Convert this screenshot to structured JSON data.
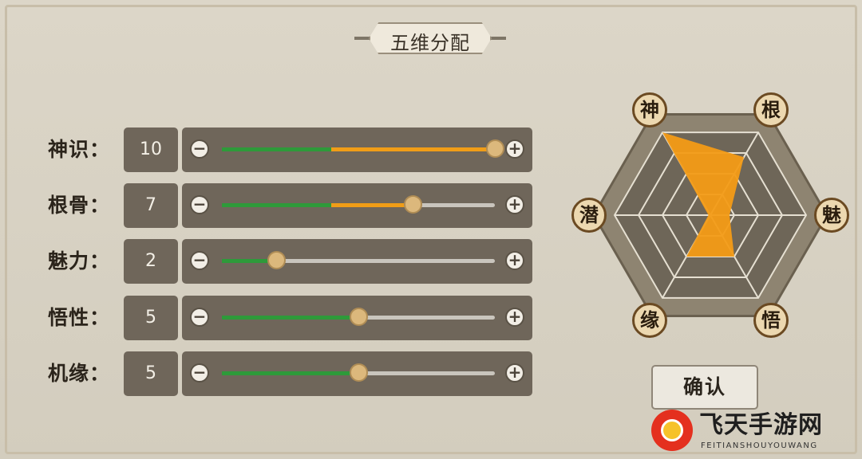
{
  "title": "五维分配",
  "attributes": [
    {
      "label": "神识：",
      "value": "10",
      "fraction": 1.0,
      "green": 0.4
    },
    {
      "label": "根骨：",
      "value": "7",
      "fraction": 0.7,
      "green": 0.4
    },
    {
      "label": "魅力：",
      "value": "2",
      "fraction": 0.2,
      "green": 0.2
    },
    {
      "label": "悟性：",
      "value": "5",
      "fraction": 0.5,
      "green": 0.5
    },
    {
      "label": "机缘：",
      "value": "5",
      "fraction": 0.5,
      "green": 0.5
    }
  ],
  "controls": {
    "minus": "−",
    "plus": "+"
  },
  "radar": {
    "nodes": [
      "神",
      "根",
      "魅",
      "悟",
      "缘",
      "潜"
    ],
    "fill_color": "#f39b16",
    "values": [
      1.0,
      0.7,
      0.2,
      0.5,
      0.5,
      0.0
    ]
  },
  "confirm_label": "确认",
  "watermark": {
    "name": "飞天手游网",
    "sub": "FEITIANSHOUYOUWANG"
  }
}
